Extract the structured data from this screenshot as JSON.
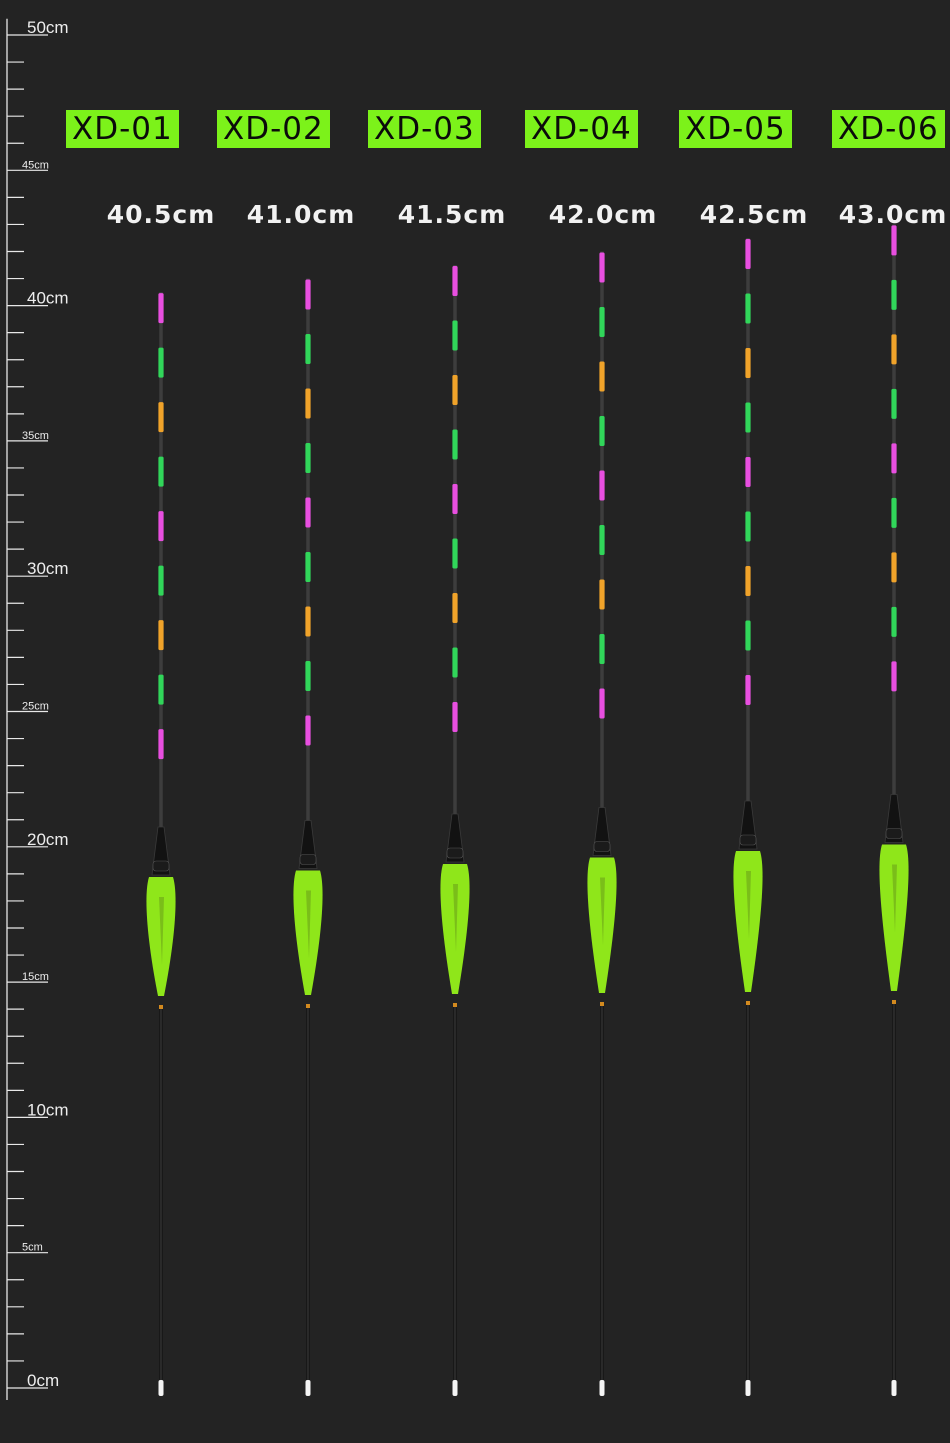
{
  "ruler": {
    "major_labels": [
      "0cm",
      "5cm",
      "10cm",
      "15cm",
      "20cm",
      "25cm",
      "30cm",
      "35cm",
      "40cm",
      "45cm",
      "50cm"
    ],
    "major_values": [
      0,
      5,
      10,
      15,
      20,
      25,
      30,
      35,
      40,
      45,
      50
    ]
  },
  "floats": [
    {
      "model": "XD-01",
      "length_label": "40.5cm",
      "length_cm": 40.5
    },
    {
      "model": "XD-02",
      "length_label": "41.0cm",
      "length_cm": 41.0
    },
    {
      "model": "XD-03",
      "length_label": "41.5cm",
      "length_cm": 41.5
    },
    {
      "model": "XD-04",
      "length_label": "42.0cm",
      "length_cm": 42.0
    },
    {
      "model": "XD-05",
      "length_label": "42.5cm",
      "length_cm": 42.5
    },
    {
      "model": "XD-06",
      "length_label": "43.0cm",
      "length_cm": 43.0
    }
  ],
  "colors": {
    "background": "#232323",
    "label_bg": "#7cf21a",
    "body": "#8fe61a",
    "seg_pink": "#e84fe0",
    "seg_green": "#31d65a",
    "seg_orange": "#f0a32a"
  },
  "segment_patterns": [
    [
      "pink",
      "green",
      "orange",
      "green",
      "pink",
      "green",
      "orange",
      "green",
      "pink"
    ],
    [
      "pink",
      "green",
      "orange",
      "green",
      "pink",
      "green",
      "orange",
      "green",
      "pink"
    ],
    [
      "pink",
      "green",
      "orange",
      "green",
      "pink",
      "green",
      "orange",
      "green",
      "pink"
    ],
    [
      "pink",
      "green",
      "orange",
      "green",
      "pink",
      "green",
      "orange",
      "green",
      "pink"
    ],
    [
      "pink",
      "green",
      "orange",
      "green",
      "pink",
      "green",
      "orange",
      "green",
      "pink"
    ],
    [
      "pink",
      "green",
      "orange",
      "green",
      "pink",
      "green",
      "orange",
      "green",
      "pink"
    ]
  ]
}
